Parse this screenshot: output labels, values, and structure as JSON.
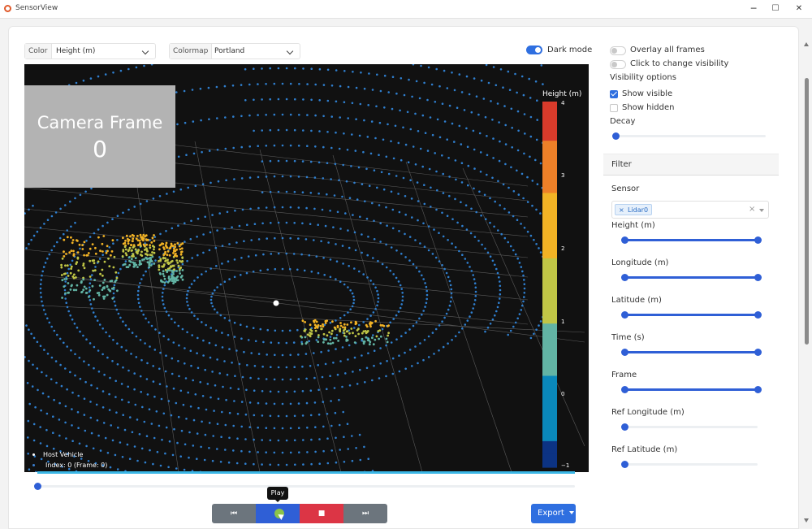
{
  "window": {
    "title": "SensorView",
    "minimize": "─",
    "maximize": "☐",
    "close": "✕"
  },
  "toolbar": {
    "color_label": "Color",
    "color_value": "Height (m)",
    "colormap_label": "Colormap",
    "colormap_value": "Portland",
    "dark_mode_label": "Dark mode",
    "dark_mode_on": true
  },
  "plot": {
    "camera_title": "Camera Frame",
    "camera_frame": "0",
    "legend_host": "Host Vehicle",
    "legend_index": "Index: 0 (Frame: 0)",
    "colorbar_title": "Height (m)",
    "colorbar_ticks": [
      "4",
      "3",
      "2",
      "1",
      "0",
      "−1"
    ]
  },
  "playback": {
    "tooltip": "Play",
    "first_icon": "⏮",
    "stop_icon": "■",
    "last_icon": "⏭",
    "export_label": "Export",
    "frame_slider": 0
  },
  "right_panel": {
    "overlay_label": "Overlay all frames",
    "click_label": "Click to change visibility",
    "visibility_heading": "Visibility options",
    "show_visible": "Show visible",
    "show_hidden": "Show hidden",
    "show_visible_checked": true,
    "show_hidden_checked": false,
    "decay_label": "Decay",
    "filter_title": "Filter",
    "sensor_label": "Sensor",
    "sensor_chip": "Lidar0",
    "sensor_chip_remove": "×",
    "clear_icon": "×",
    "sliders": [
      {
        "label": "Height (m)",
        "range": [
          0,
          1
        ]
      },
      {
        "label": "Longitude (m)",
        "range": [
          0,
          1
        ]
      },
      {
        "label": "Latitude (m)",
        "range": [
          0,
          1
        ]
      },
      {
        "label": "Time (s)",
        "range": [
          0,
          1
        ]
      },
      {
        "label": "Frame",
        "range": [
          0,
          1
        ]
      },
      {
        "label": "Ref Longitude (m)",
        "range": [
          0,
          0
        ]
      },
      {
        "label": "Ref Latitude (m)",
        "range": [
          0,
          0
        ]
      }
    ]
  },
  "colors": {
    "accent": "#2f5fd6",
    "stop": "#dc3545",
    "nav": "#6c757d",
    "play": "#2f5fd6",
    "export": "#2f6fe0"
  }
}
